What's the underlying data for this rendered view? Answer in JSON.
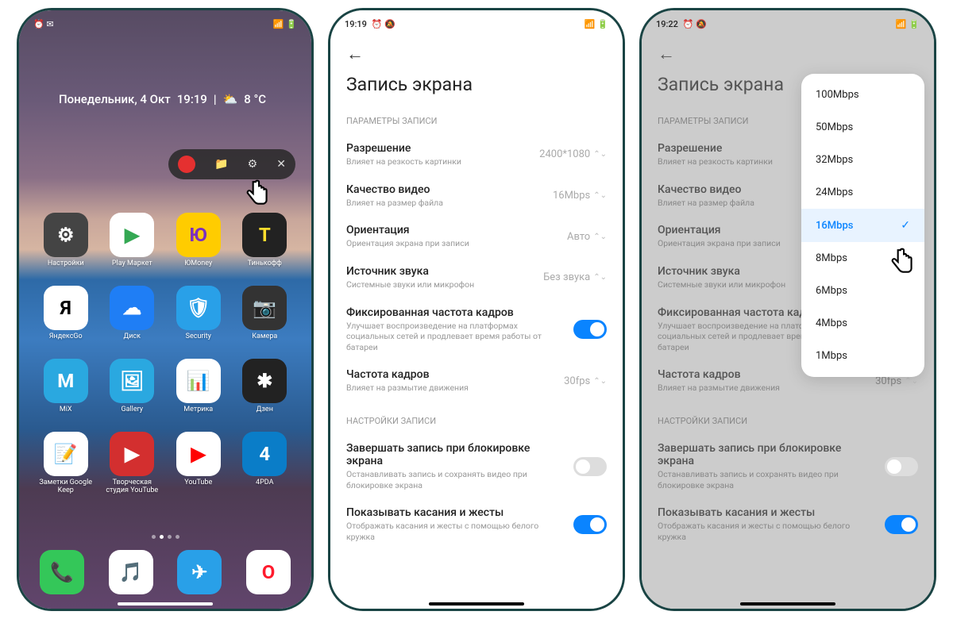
{
  "phone1": {
    "status": {
      "time_area": "",
      "icons_left": "⏰ ✉",
      "signal": "📶 🔋"
    },
    "weather": {
      "day": "Понедельник, 4 Окт",
      "time": "19:19",
      "sep": "|",
      "icon": "⛅",
      "temp": "8 °С"
    },
    "recorder": {
      "settings_icon": "⚙",
      "folder_icon": "📁",
      "close_icon": "✕"
    },
    "apps": [
      {
        "label": "Настройки",
        "bg": "#444",
        "glyph": "⚙"
      },
      {
        "label": "Play Маркет",
        "bg": "#fff",
        "glyph": "▶",
        "fg": "#34a853"
      },
      {
        "label": "ЮMoney",
        "bg": "#ffcc00",
        "glyph": "Ю",
        "fg": "#7b2fbf"
      },
      {
        "label": "Тинькофф",
        "bg": "#222",
        "glyph": "T",
        "fg": "#ffdd2d"
      },
      {
        "label": "ЯндексGo",
        "bg": "#fff",
        "glyph": "Я",
        "fg": "#000"
      },
      {
        "label": "Диск",
        "bg": "#1f7ef5",
        "glyph": "☁"
      },
      {
        "label": "Security",
        "bg": "#29a0e8",
        "glyph": "🛡"
      },
      {
        "label": "Камера",
        "bg": "#333",
        "glyph": "📷"
      },
      {
        "label": "MiX",
        "bg": "#2aa8e0",
        "glyph": "M"
      },
      {
        "label": "Gallery",
        "bg": "#2aa8e0",
        "glyph": "🖼"
      },
      {
        "label": "Метрика",
        "bg": "#fff",
        "glyph": "📊",
        "fg": "#000"
      },
      {
        "label": "Дзен",
        "bg": "#222",
        "glyph": "✱"
      },
      {
        "label": "Заметки Google Keep",
        "bg": "#fff",
        "glyph": "📝",
        "fg": "#fbbc04"
      },
      {
        "label": "Творческая студия YouTube",
        "bg": "#d32f2f",
        "glyph": "▶"
      },
      {
        "label": "YouTube",
        "bg": "#fff",
        "glyph": "▶",
        "fg": "#ff0000"
      },
      {
        "label": "4PDA",
        "bg": "#0a7dc8",
        "glyph": "4"
      }
    ],
    "dock": [
      {
        "bg": "#34c759",
        "glyph": "📞"
      },
      {
        "bg": "#fff",
        "glyph": "🎵",
        "fg": "#ff3b30"
      },
      {
        "bg": "#29a0e8",
        "glyph": "✈"
      },
      {
        "bg": "#fff",
        "glyph": "O",
        "fg": "#ff1b2d"
      }
    ]
  },
  "phone2": {
    "status": {
      "time": "19:19",
      "icons": "⏰ 🔕",
      "right": "📶 🔋"
    },
    "title": "Запись экрана",
    "section1": "ПАРАМЕТРЫ ЗАПИСИ",
    "rows": [
      {
        "title": "Разрешение",
        "sub": "Влияет на резкость картинки",
        "value": "2400*1080"
      },
      {
        "title": "Качество видео",
        "sub": "Влияет на размер файла",
        "value": "16Mbps"
      },
      {
        "title": "Ориентация",
        "sub": "Ориентация экрана при записи",
        "value": "Авто"
      },
      {
        "title": "Источник звука",
        "sub": "Системные звуки или микрофон",
        "value": "Без звука"
      },
      {
        "title": "Фиксированная частота кадров",
        "sub": "Улучшает воспроизведение на платформах социальных сетей и продлевает время работы от батареи",
        "toggle": "on"
      },
      {
        "title": "Частота кадров",
        "sub": "Влияет на размытие движения",
        "value": "30fps"
      }
    ],
    "section2": "НАСТРОЙКИ ЗАПИСИ",
    "rows2": [
      {
        "title": "Завершать запись при блокировке экрана",
        "sub": "Останавливать запись и сохранять видео при блокировке экрана",
        "toggle": "off"
      },
      {
        "title": "Показывать касания и жесты",
        "sub": "Отображать касания и жесты с помощью белого кружка",
        "toggle": "on"
      }
    ]
  },
  "phone3": {
    "status": {
      "time": "19:22",
      "icons": "⏰ 🔕",
      "right": "📶 🔋"
    },
    "popup": {
      "options": [
        "100Mbps",
        "50Mbps",
        "32Mbps",
        "24Mbps",
        "16Mbps",
        "8Mbps",
        "6Mbps",
        "4Mbps",
        "1Mbps"
      ],
      "selected": "16Mbps"
    }
  }
}
